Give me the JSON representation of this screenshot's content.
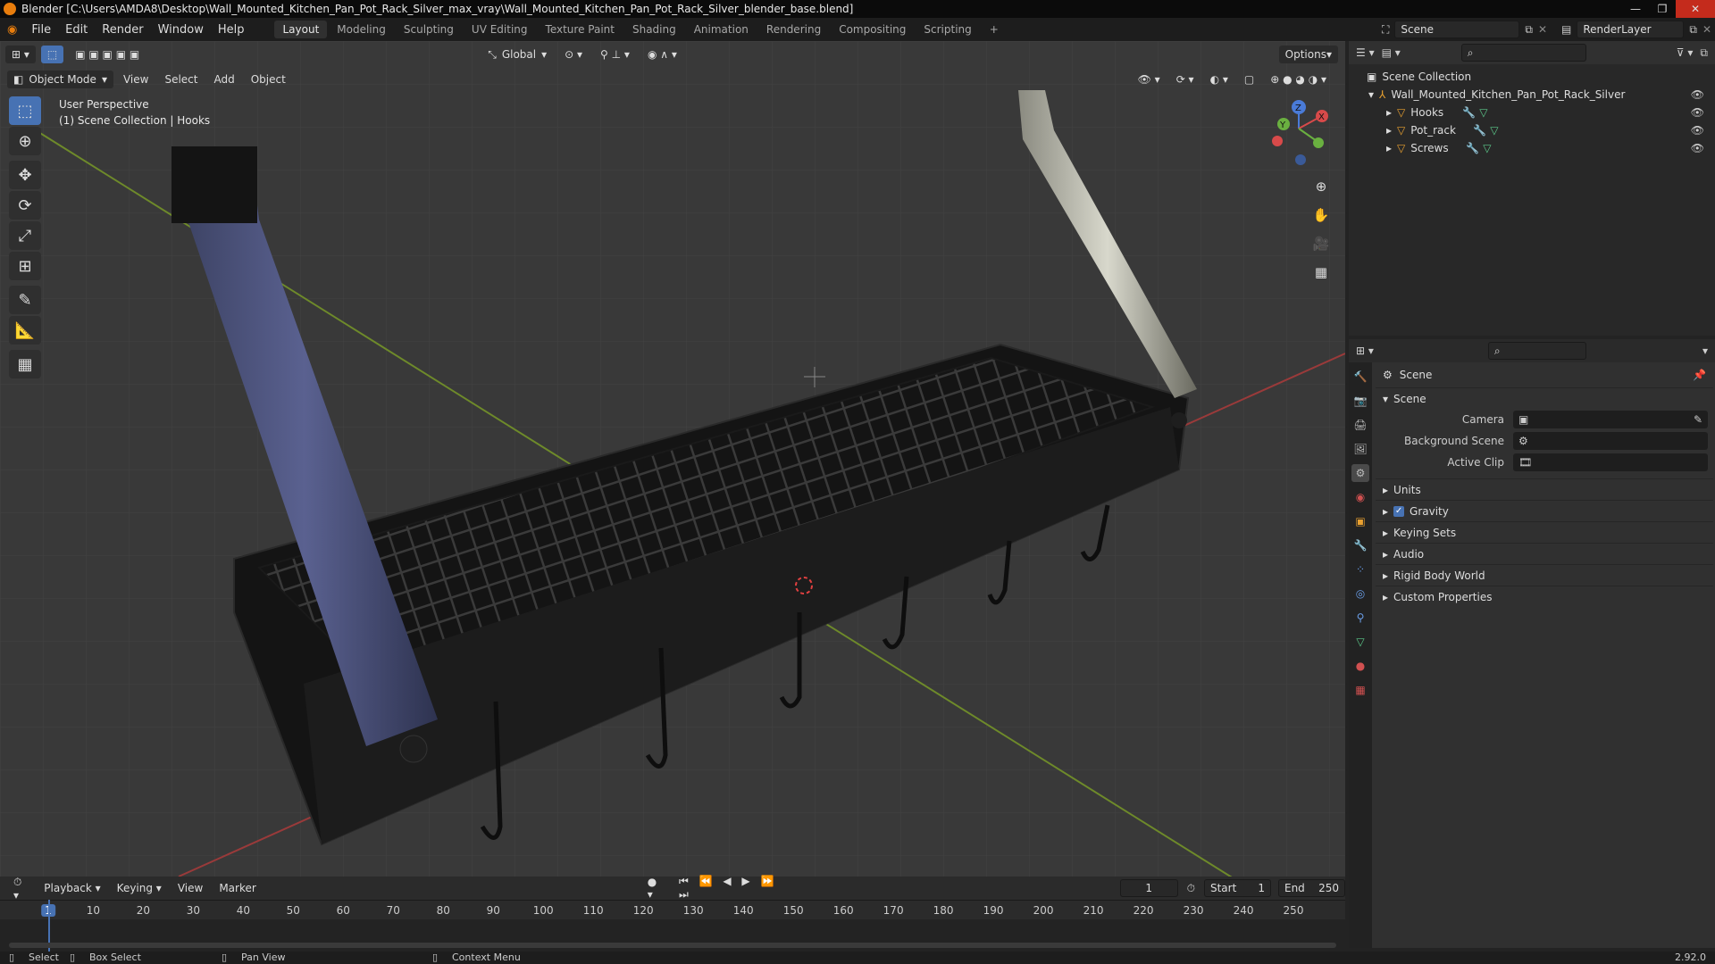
{
  "window": {
    "title": "Blender [C:\\Users\\AMDA8\\Desktop\\Wall_Mounted_Kitchen_Pan_Pot_Rack_Silver_max_vray\\Wall_Mounted_Kitchen_Pan_Pot_Rack_Silver_blender_base.blend]"
  },
  "menu": [
    "File",
    "Edit",
    "Render",
    "Window",
    "Help"
  ],
  "workspaces": [
    "Layout",
    "Modeling",
    "Sculpting",
    "UV Editing",
    "Texture Paint",
    "Shading",
    "Animation",
    "Rendering",
    "Compositing",
    "Scripting"
  ],
  "active_workspace": "Layout",
  "scene_field": "Scene",
  "renderlayer_field": "RenderLayer",
  "viewport": {
    "mode": "Object Mode",
    "menus": [
      "View",
      "Select",
      "Add",
      "Object"
    ],
    "orientation": "Global",
    "options_label": "Options",
    "info_line1": "User Perspective",
    "info_line2": "(1) Scene Collection | Hooks",
    "gizmo_x": "X",
    "gizmo_y": "Y",
    "gizmo_z": "Z"
  },
  "outliner": {
    "root": "Scene Collection",
    "collection": "Wall_Mounted_Kitchen_Pan_Pot_Rack_Silver",
    "objects": [
      "Hooks",
      "Pot_rack",
      "Screws"
    ]
  },
  "properties": {
    "header": "Scene",
    "section": "Scene",
    "camera_label": "Camera",
    "bg_scene_label": "Background Scene",
    "active_clip_label": "Active Clip",
    "panels": [
      "Units",
      "Gravity",
      "Keying Sets",
      "Audio",
      "Rigid Body World",
      "Custom Properties"
    ]
  },
  "timeline": {
    "menus": [
      "Playback",
      "Keying",
      "View",
      "Marker"
    ],
    "current_frame": "1",
    "start_label": "Start",
    "start": "1",
    "end_label": "End",
    "end": "250",
    "ticks": [
      "1",
      "10",
      "20",
      "30",
      "40",
      "50",
      "60",
      "70",
      "80",
      "90",
      "100",
      "110",
      "120",
      "130",
      "140",
      "150",
      "160",
      "170",
      "180",
      "190",
      "200",
      "210",
      "220",
      "230",
      "240",
      "250"
    ]
  },
  "status": {
    "select": "Select",
    "box_select": "Box Select",
    "pan_view": "Pan View",
    "context_menu": "Context Menu",
    "version": "2.92.0"
  }
}
